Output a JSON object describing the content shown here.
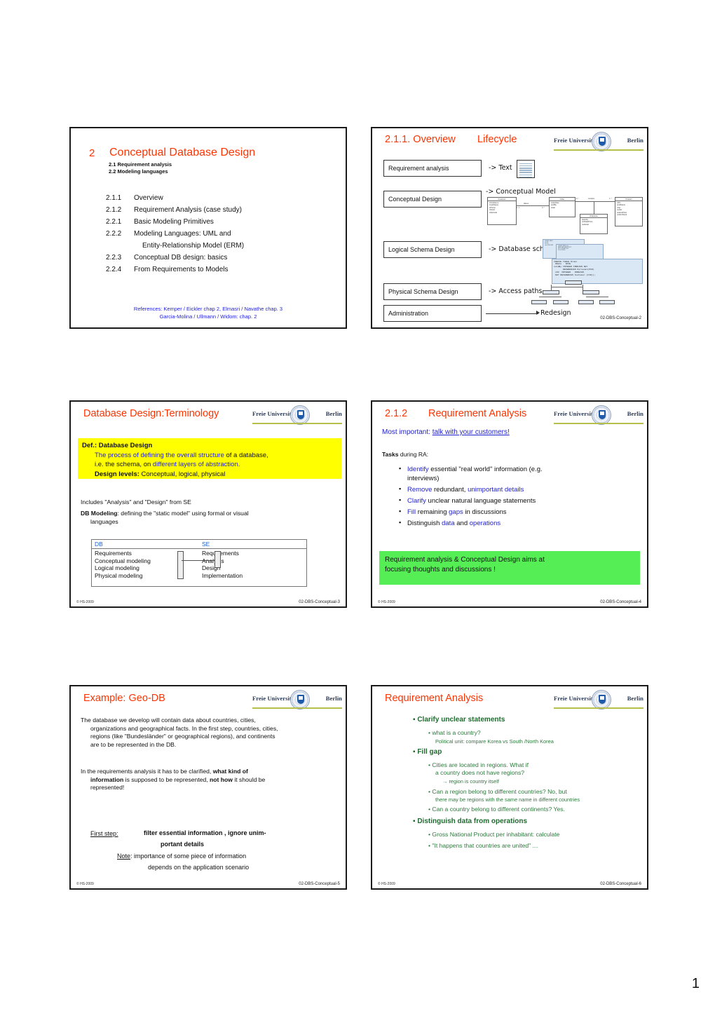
{
  "document": {
    "page_number": "1"
  },
  "logo": {
    "left_word": "Freie Universität",
    "right_word": "Berlin"
  },
  "slide1": {
    "number": "2",
    "title": "Conceptual Database Design",
    "sub1": "2.1 Requirement analysis",
    "sub2": "2.2 Modeling languages",
    "toc": [
      {
        "num": "2.1.1",
        "text": "Overview"
      },
      {
        "num": "2.1.2",
        "text": "Requirement Analysis (case study)"
      },
      {
        "num": "2.2.1",
        "text": "Basic Modeling Primitives"
      },
      {
        "num": "2.2.2",
        "text": "Modeling Languages: UML and"
      },
      {
        "num": "",
        "text": "Entity-Relationship Model  (ERM)"
      },
      {
        "num": "2.2.3",
        "text": "Conceptual DB design: basics"
      },
      {
        "num": "2.2.4",
        "text": "From Requirements to Models"
      }
    ],
    "references_line1": "References: Kemper / Eickler chap 2, Elmasri / Navathe chap. 3",
    "references_line2": "Garcia-Molina / Ullmann / Widom: chap. 2"
  },
  "slide2": {
    "title_num": "2.1.1. Overview",
    "title_word": "Lifecycle",
    "stages": [
      "Requirement analysis",
      "Conceptual Design",
      "Logical Schema Design",
      "Physical Schema Design",
      "Administration"
    ],
    "arrows": [
      "-> Text",
      "-> Conceptual Model",
      "-> Database schema",
      "-> Access paths",
      "Redesign"
    ],
    "uml": {
      "customer": {
        "name": "Customer",
        "attrs": "cFirstName\ncLastName\ncPhone\ncStreet\ncZipCode"
      },
      "order": {
        "name": "Order",
        "attrs": "orderDate\nsoldBy\n/total"
      },
      "orderline": {
        "name": "OrderLine",
        "attrs": "quantity\nunitSalePrice\n/subtotal"
      },
      "product": {
        "name": "Product",
        "attrs": "UPC\nprodName\nmfgr\nmodel\nunitListPrice\nunitsInStock"
      },
      "labels": [
        "places",
        "1..1",
        "0..*",
        "0..*",
        "contains",
        "1..*"
      ]
    },
    "sql": "CREATE TABLE Order\n ODate   DATE\nsoldBy INTEGER FOREIGN KEY\n       REFERENCES Personal(PID)\n cID  INTEGER   FOREIGN\n KEY REFERENCES Customer (CID));",
    "footer_right": "02-DBS-Conceptual-2"
  },
  "slide3": {
    "title": "Database Design:Terminology",
    "def_heading": "Def.: Database Design",
    "def_l1_a": "The process of defining the overall structure",
    "def_l1_b": " of a  database,",
    "def_l2_a": "i.e. the schema, on ",
    "def_l2_b": "different layers of abstraction.",
    "def_l3_a": "Design levels:",
    "def_l3_b": "  Conceptual, logical, physical",
    "body1": "Includes \"Analysis\" and \"Design\"  from SE",
    "body2_bold": "DB Modeling",
    "body2_rest": ": defining the \"static model\" using  formal or visual",
    "body2_cont": "languages",
    "table": {
      "headers": [
        "DB",
        "SE"
      ],
      "db_rows": [
        "Requirements",
        "Conceptual modeling",
        "Logical modeling",
        "Physical modeling"
      ],
      "se_rows": [
        "Requirements",
        "Analysis",
        "Design",
        "Implementation"
      ]
    },
    "footer_left": "© HS-2009",
    "footer_right": "02-DBS-Conceptual-3"
  },
  "slide4": {
    "title_num": "2.1.2",
    "title_text": "Requirement Analysis",
    "lead_plain": "Most important: ",
    "lead_underline": "talk with your customers!",
    "tasks_bold": "Tasks",
    "tasks_rest": " during RA:",
    "bullets": [
      {
        "hl": "Identify",
        "rest": "  essential \"real world\" information (e.g.",
        "cont": "interviews)"
      },
      {
        "hl": "Remove",
        "rest": " redundant, ",
        "hl2": "unimportant details"
      },
      {
        "hl": "Clarify",
        "rest": " unclear natural language statements"
      },
      {
        "hl": "Fill",
        "rest": " remaining ",
        "hl2": "gaps",
        "rest2": " in discussions"
      },
      {
        "plain": "Distinguish ",
        "hl2": "data",
        "rest2": " and ",
        "hl3": "operations"
      }
    ],
    "greenbox_l1": "Requirement analysis & Conceptual Design aims at",
    "greenbox_l2": "focusing thoughts and discussions !",
    "footer_left": "© HS-2009",
    "footer_right": "02-DBS-Conceptual-4"
  },
  "slide5": {
    "title": "Example: Geo-DB",
    "p1_l1": "The database we develop will contain data about countries, cities,",
    "p1_l2": "organizations and geographical facts. In the first step, countries, cities,",
    "p1_l3": "regions (like \"Bundesländer\" or geographical regions), and continents",
    "p1_l4": "are to be represented in the DB.",
    "p2_l1a": "In the requirements analysis it has to be clarified, ",
    "p2_l1b": "what kind of",
    "p2_l2a": "information",
    "p2_l2b": " is supposed to be represented, ",
    "p2_l2c": "not how",
    "p2_l2d": " it should be",
    "p2_l3": "represented!",
    "first_step_label": "First step:",
    "first_step_l1": "filter essential information , ignore unim-",
    "first_step_l2": "portant details",
    "note_label": "Note",
    "note_l1": ": importance of some piece of information",
    "note_l2": "depends on the application scenario",
    "footer_left": "© HS-2009",
    "footer_right": "02-DBS-Conceptual-5"
  },
  "slide6": {
    "title": "Requirement Analysis",
    "h1": "Clarify unclear statements",
    "h1_b1": "what is a country?",
    "h1_b1_sub": "Political unit: compare Korea vs South /North Korea",
    "h2": "Fill gap",
    "h2_b1_l1": "Cities are located in regions. What if",
    "h2_b1_l2": "a country does not have regions?",
    "h2_b1_sub": "→ region is country itself",
    "h2_b2": "Can a region belong to different countries? No, but",
    "h2_b2_sub": "there may be regions with the same name in different countries",
    "h2_b3": "Can a country belong to different continents? Yes.",
    "h3": "Distinguish data from operations",
    "h3_b1": "Gross National Product per inhabitant: calculate",
    "h3_b2": "\"It happens that countries are united\"",
    "h3_b2_tail": "....",
    "footer_left": "© HS-2009",
    "footer_right": "02-DBS-Conceptual-6"
  }
}
